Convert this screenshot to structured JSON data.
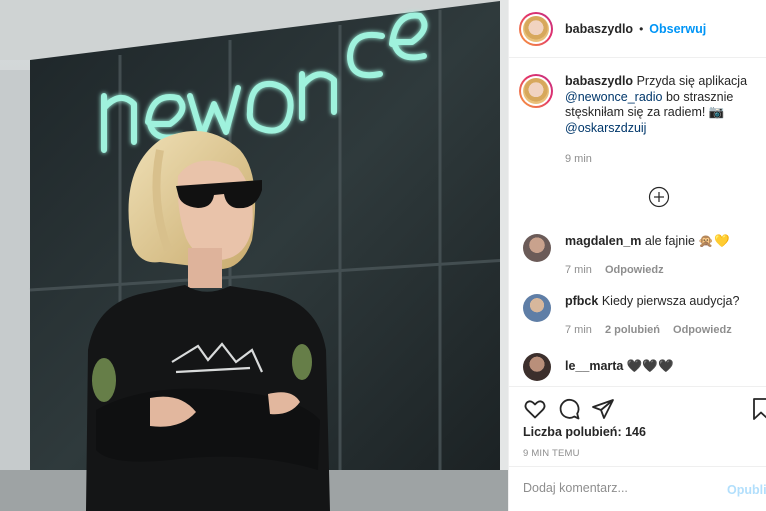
{
  "photo": {
    "description_icon": "post-photo",
    "sign_text": "newonce"
  },
  "header": {
    "username": "babaszydlo",
    "separator": "•",
    "follow_label": "Obserwuj"
  },
  "caption": {
    "username": "babaszydlo",
    "text_1": "Przyda się aplikacja",
    "mention_1": "@newonce_radio",
    "text_2": "bo strasznie stęskniłam się za radiem! 📷",
    "mention_2": "@oskarszdzuij",
    "time": "9 min"
  },
  "comments": [
    {
      "username": "magdalen_m",
      "text": "ale fajnie 🙊💛",
      "time": "7 min",
      "likes": "",
      "reply": "Odpowiedz"
    },
    {
      "username": "pfbck",
      "text": "Kiedy pierwsza audycja?",
      "time": "7 min",
      "likes": "2 polubień",
      "reply": "Odpowiedz"
    },
    {
      "username": "le__marta",
      "text": "🖤🖤🖤"
    }
  ],
  "actions": {
    "icons": [
      "heart-icon",
      "comment-icon",
      "share-icon",
      "save-icon"
    ],
    "likes_label": "Liczba polubień: 146",
    "post_time": "9 MIN TEMU"
  },
  "add_comment": {
    "placeholder": "Dodaj komentarz...",
    "publish_label": "Opublikuj"
  },
  "colors": {
    "link": "#0095f6",
    "mention": "#00376b",
    "muted": "#8e8e8e",
    "publish_disabled": "#b2dffc"
  }
}
